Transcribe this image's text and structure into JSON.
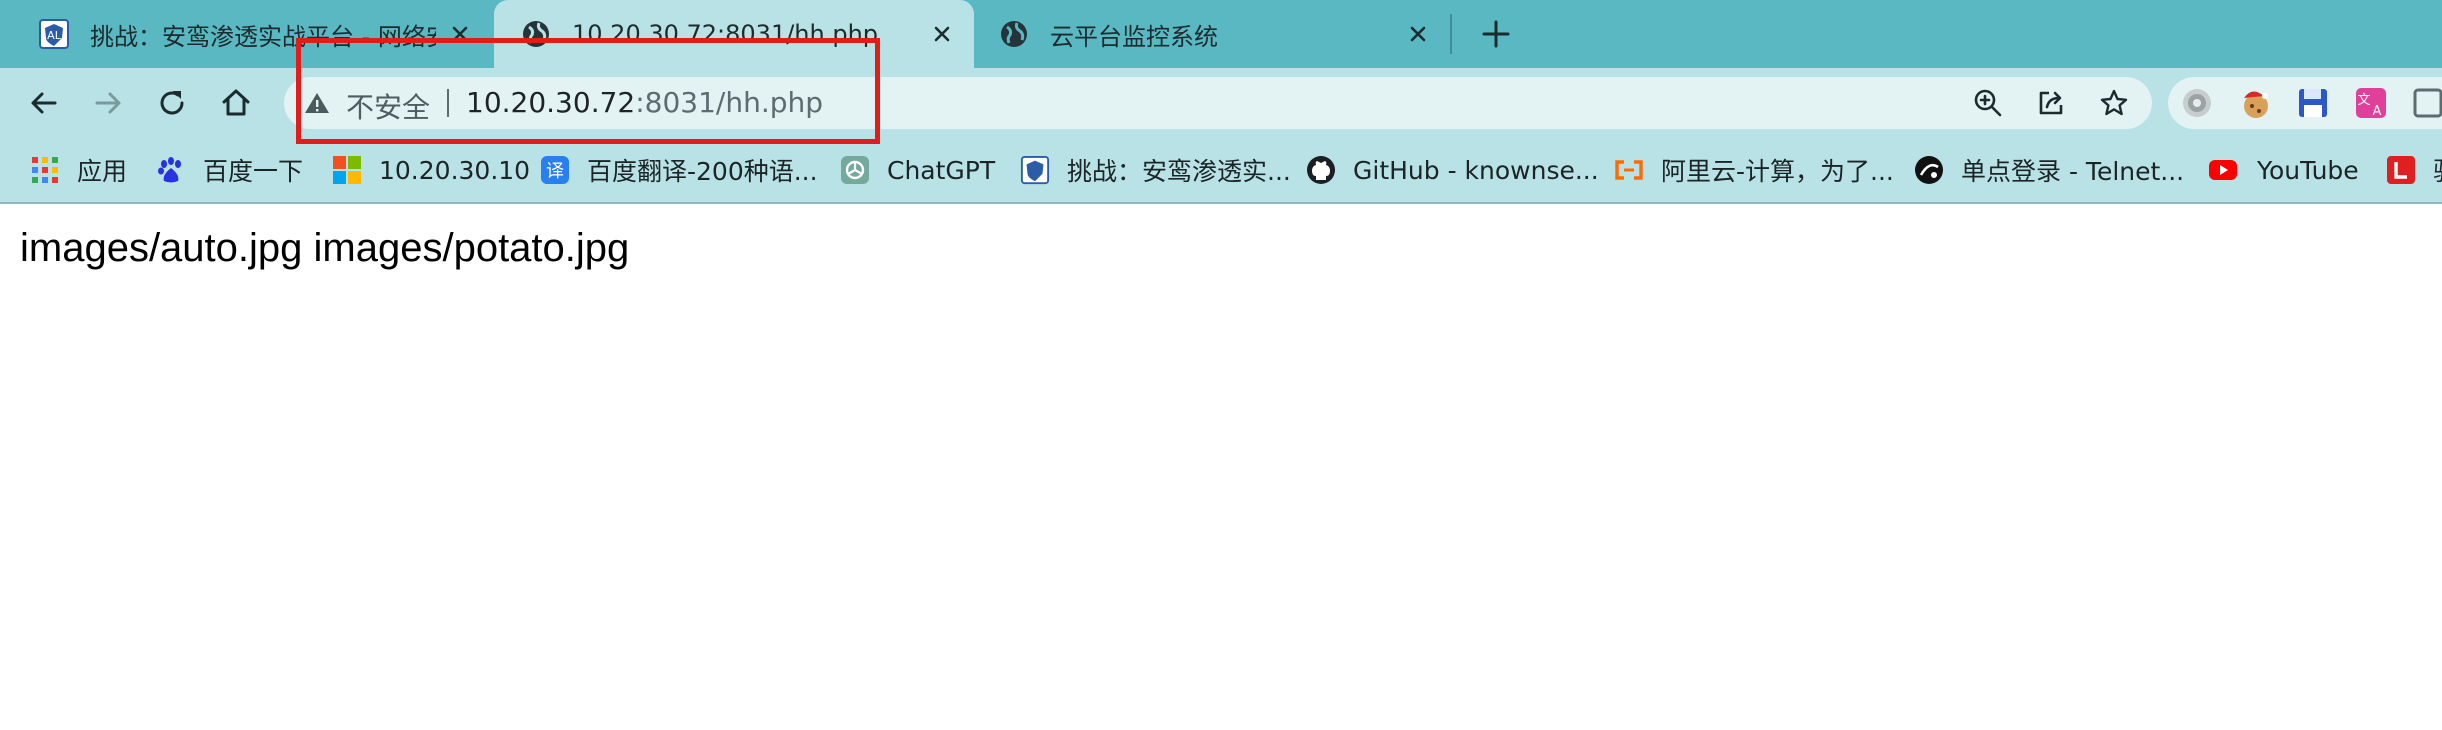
{
  "tabs": [
    {
      "title": "挑战：安鸾渗透实战平台 - 网络安",
      "icon": "shield-logo-icon",
      "active": false
    },
    {
      "title": "10.20.30.72:8031/hh.php",
      "icon": "globe-icon",
      "active": true
    },
    {
      "title": "云平台监控系统",
      "icon": "globe-icon",
      "active": false
    }
  ],
  "omnibox": {
    "security_label": "不安全",
    "url_host": "10.20.30.72",
    "url_rest": ":8031/hh.php"
  },
  "bookmarks": [
    {
      "label": "应用",
      "icon": "apps-grid-icon"
    },
    {
      "label": "百度一下",
      "icon": "baidu-paw-icon"
    },
    {
      "label": "10.20.30.10",
      "icon": "windows-logo-icon"
    },
    {
      "label": "百度翻译-200种语...",
      "icon": "baidu-translate-icon"
    },
    {
      "label": "ChatGPT",
      "icon": "chatgpt-icon"
    },
    {
      "label": "挑战：安鸾渗透实...",
      "icon": "shield-logo-icon"
    },
    {
      "label": "GitHub - knownse...",
      "icon": "github-icon"
    },
    {
      "label": "阿里云-计算，为了...",
      "icon": "aliyun-icon"
    },
    {
      "label": "单点登录 - Telnet...",
      "icon": "telnet-icon"
    },
    {
      "label": "YouTube",
      "icon": "youtube-icon"
    },
    {
      "label": "驿",
      "icon": "red-l-icon"
    }
  ],
  "page": {
    "text": "images/auto.jpg images/potato.jpg"
  },
  "colors": {
    "tab_strip": "#5ab8c3",
    "toolbar": "#b9e2e6",
    "omnibox": "#e3f2f3",
    "annotation": "#e21b1b"
  }
}
